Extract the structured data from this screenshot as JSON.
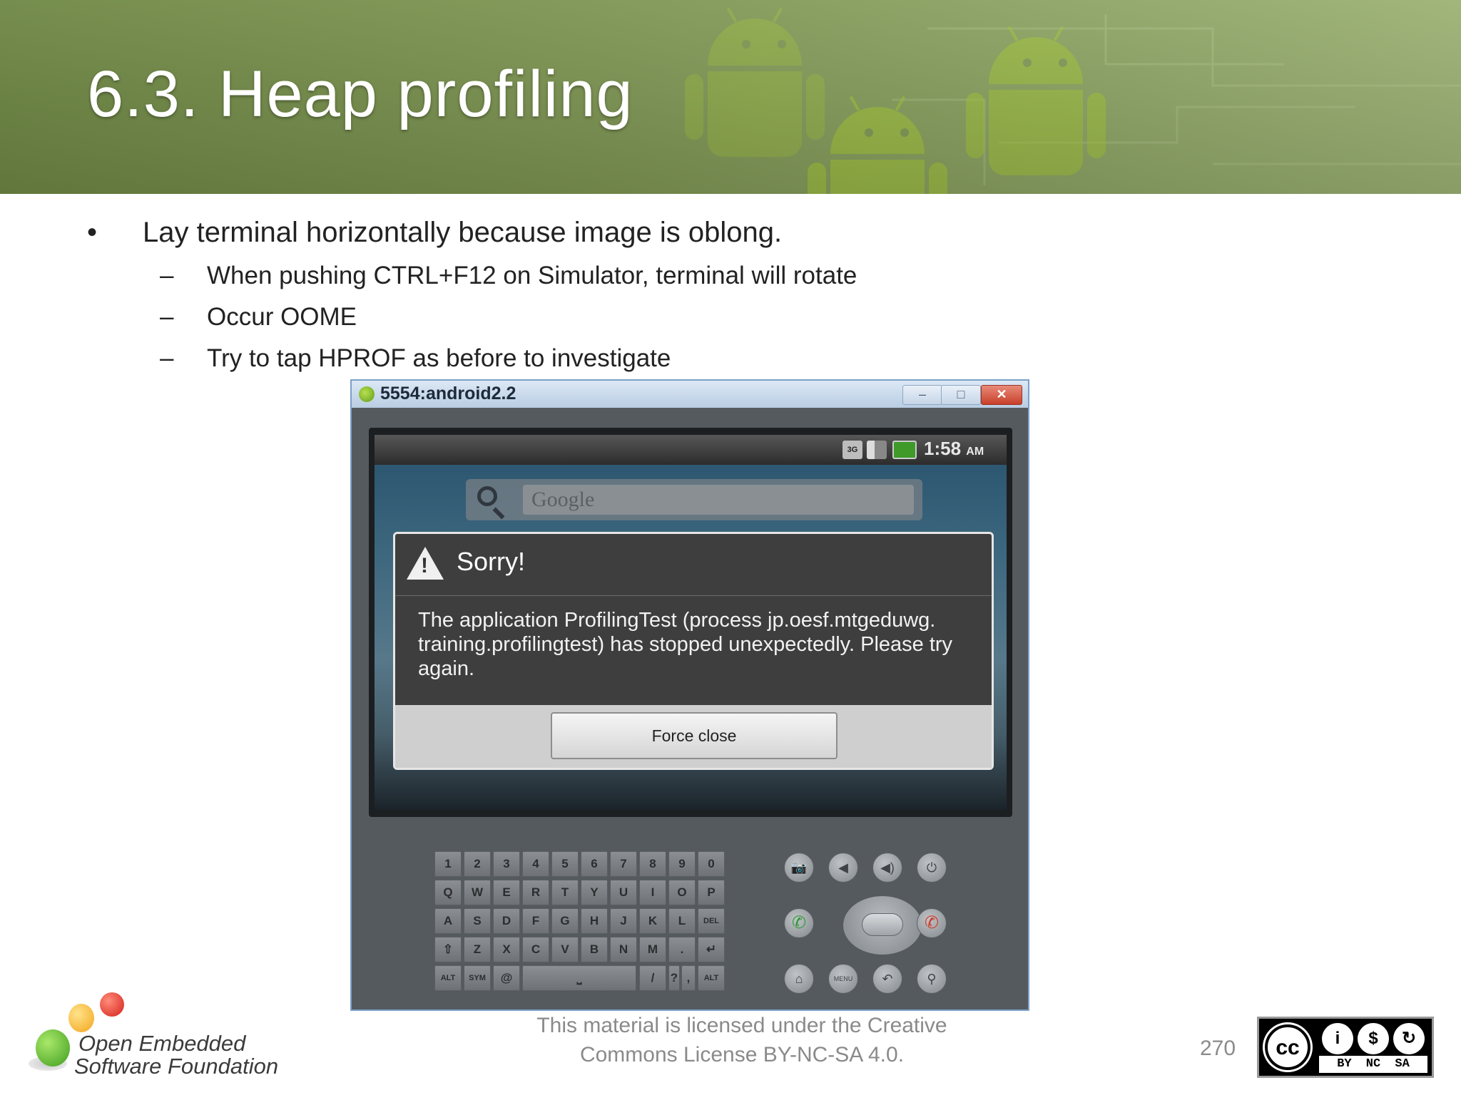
{
  "slide": {
    "title": "6.3. Heap profiling",
    "bullet_main": "Lay terminal horizontally because image is oblong.",
    "sub_bullets": [
      "When pushing CTRL+F12 on Simulator, terminal will rotate",
      "Occur OOME",
      "Try to tap HPROF as before to investigate"
    ],
    "bullet_char": "•",
    "dash_char": "–"
  },
  "emulator": {
    "window_title": "5554:android2.2",
    "window_buttons": {
      "minimize": "–",
      "maximize": "□",
      "close": "✕"
    },
    "status": {
      "network": "3G",
      "time": "1:58",
      "ampm": "AM"
    },
    "search_placeholder": "Google",
    "dialog": {
      "title": "Sorry!",
      "message": "The application ProfilingTest (process jp.oesf.mtgeduwg. training.profilingtest) has stopped unexpectedly. Please try again.",
      "button": "Force close"
    },
    "keyboard_rows": [
      [
        "1",
        "2",
        "3",
        "4",
        "5",
        "6",
        "7",
        "8",
        "9",
        "0"
      ],
      [
        "Q",
        "W",
        "E",
        "R",
        "T",
        "Y",
        "U",
        "I",
        "O",
        "P"
      ],
      [
        "A",
        "S",
        "D",
        "F",
        "G",
        "H",
        "J",
        "K",
        "L",
        "DEL"
      ],
      [
        "⇧",
        "Z",
        "X",
        "C",
        "V",
        "B",
        "N",
        "M",
        ".",
        "↵"
      ],
      [
        "ALT",
        "SYM",
        "@",
        "⎵",
        "/",
        "?",
        ",",
        "ALT"
      ]
    ],
    "controls": {
      "camera": "📷",
      "vol_down": "◀",
      "vol_up": "◀)",
      "power": "⏻",
      "call": "✆",
      "end_call": "✆",
      "home": "⌂",
      "menu": "MENU",
      "back": "↶",
      "search": "⚲"
    }
  },
  "footer": {
    "logo_line1": "Open Embedded",
    "logo_line2": "Software Foundation",
    "license_line1": "This material is licensed under the Creative",
    "license_line2": "Commons License BY-NC-SA 4.0.",
    "page_number": "270",
    "cc_badge": {
      "cc": "cc",
      "by": "BY",
      "nc": "NC",
      "sa": "SA"
    }
  },
  "colors": {
    "header_green": "#7e9553",
    "android_green": "#a4c639",
    "dialog_dark": "#3e3e3e"
  }
}
